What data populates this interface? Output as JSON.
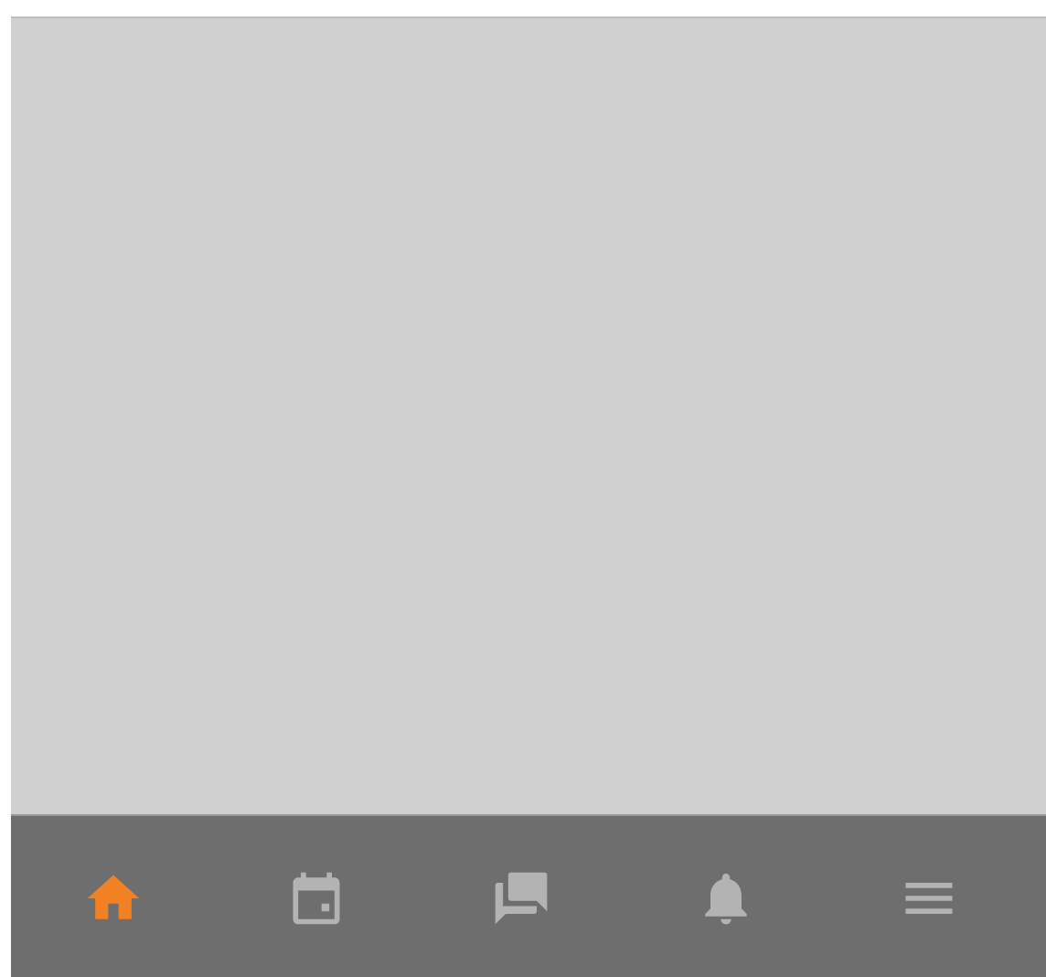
{
  "nav_tabs": [
    {
      "kind": "home",
      "selected": true
    },
    {
      "kind": "calendar",
      "selected": false
    },
    {
      "kind": "chat",
      "selected": false
    },
    {
      "kind": "bell",
      "selected": false
    },
    {
      "kind": "menu",
      "selected": false
    }
  ]
}
